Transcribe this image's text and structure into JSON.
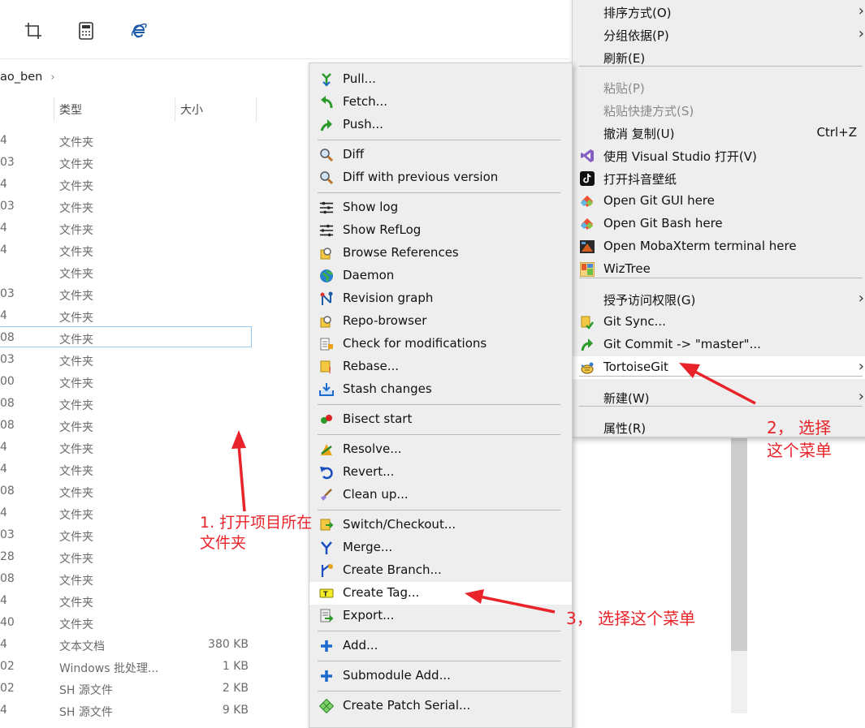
{
  "breadcrumb": {
    "current": "ao_ben",
    "sep": "›"
  },
  "columns": {
    "type": "类型",
    "size": "大小"
  },
  "files": [
    {
      "date": "4",
      "type": "文件夹",
      "size": ""
    },
    {
      "date": "03",
      "type": "文件夹",
      "size": ""
    },
    {
      "date": "4",
      "type": "文件夹",
      "size": ""
    },
    {
      "date": "03",
      "type": "文件夹",
      "size": ""
    },
    {
      "date": "4",
      "type": "文件夹",
      "size": ""
    },
    {
      "date": "4",
      "type": "文件夹",
      "size": ""
    },
    {
      "date": "",
      "type": "文件夹",
      "size": ""
    },
    {
      "date": "03",
      "type": "文件夹",
      "size": ""
    },
    {
      "date": "4",
      "type": "文件夹",
      "size": ""
    },
    {
      "date": "08",
      "type": "文件夹",
      "size": ""
    },
    {
      "date": "03",
      "type": "文件夹",
      "size": ""
    },
    {
      "date": "00",
      "type": "文件夹",
      "size": ""
    },
    {
      "date": "08",
      "type": "文件夹",
      "size": ""
    },
    {
      "date": "08",
      "type": "文件夹",
      "size": ""
    },
    {
      "date": "4",
      "type": "文件夹",
      "size": ""
    },
    {
      "date": "4",
      "type": "文件夹",
      "size": ""
    },
    {
      "date": "08",
      "type": "文件夹",
      "size": ""
    },
    {
      "date": "4",
      "type": "文件夹",
      "size": ""
    },
    {
      "date": "03",
      "type": "文件夹",
      "size": ""
    },
    {
      "date": "28",
      "type": "文件夹",
      "size": ""
    },
    {
      "date": "08",
      "type": "文件夹",
      "size": ""
    },
    {
      "date": "4",
      "type": "文件夹",
      "size": ""
    },
    {
      "date": "40",
      "type": "文件夹",
      "size": ""
    },
    {
      "date": "4",
      "type": "文本文档",
      "size": "380 KB"
    },
    {
      "date": "02",
      "type": "Windows 批处理...",
      "size": "1 KB"
    },
    {
      "date": "02",
      "type": "SH 源文件",
      "size": "2 KB"
    },
    {
      "date": "4",
      "type": "SH 源文件",
      "size": "9 KB"
    }
  ],
  "context_menu": {
    "items": [
      {
        "label": "排序方式(O)",
        "shortcut": "",
        "submenu": true,
        "disabled": false
      },
      {
        "label": "分组依据(P)",
        "shortcut": "",
        "submenu": true,
        "disabled": false
      },
      {
        "label": "刷新(E)",
        "shortcut": "",
        "submenu": false,
        "disabled": false
      },
      {
        "label": "粘贴(P)",
        "shortcut": "",
        "submenu": false,
        "disabled": true
      },
      {
        "label": "粘贴快捷方式(S)",
        "shortcut": "",
        "submenu": false,
        "disabled": true
      },
      {
        "label": "撤消 复制(U)",
        "shortcut": "Ctrl+Z",
        "submenu": false,
        "disabled": false
      },
      {
        "label": "使用 Visual Studio 打开(V)",
        "shortcut": "",
        "submenu": false,
        "disabled": false
      },
      {
        "label": "打开抖音壁纸",
        "shortcut": "",
        "submenu": false,
        "disabled": false
      },
      {
        "label": "Open Git GUI here",
        "shortcut": "",
        "submenu": false,
        "disabled": false
      },
      {
        "label": "Open Git Bash here",
        "shortcut": "",
        "submenu": false,
        "disabled": false
      },
      {
        "label": "Open MobaXterm terminal here",
        "shortcut": "",
        "submenu": false,
        "disabled": false
      },
      {
        "label": "WizTree",
        "shortcut": "",
        "submenu": false,
        "disabled": false
      },
      {
        "label": "授予访问权限(G)",
        "shortcut": "",
        "submenu": true,
        "disabled": false
      },
      {
        "label": "Git Sync...",
        "shortcut": "",
        "submenu": false,
        "disabled": false
      },
      {
        "label": "Git Commit -> \"master\"...",
        "shortcut": "",
        "submenu": false,
        "disabled": false
      },
      {
        "label": "TortoiseGit",
        "shortcut": "",
        "submenu": true,
        "disabled": false
      },
      {
        "label": "新建(W)",
        "shortcut": "",
        "submenu": true,
        "disabled": false
      },
      {
        "label": "属性(R)",
        "shortcut": "",
        "submenu": false,
        "disabled": false
      }
    ]
  },
  "tortoise_menu": {
    "items": [
      {
        "label": "Pull..."
      },
      {
        "label": "Fetch..."
      },
      {
        "label": "Push..."
      },
      {
        "label": "Diff"
      },
      {
        "label": "Diff with previous version"
      },
      {
        "label": "Show log"
      },
      {
        "label": "Show RefLog"
      },
      {
        "label": "Browse References"
      },
      {
        "label": "Daemon"
      },
      {
        "label": "Revision graph"
      },
      {
        "label": "Repo-browser"
      },
      {
        "label": "Check for modifications"
      },
      {
        "label": "Rebase..."
      },
      {
        "label": "Stash changes"
      },
      {
        "label": "Bisect start"
      },
      {
        "label": "Resolve..."
      },
      {
        "label": "Revert..."
      },
      {
        "label": "Clean up..."
      },
      {
        "label": "Switch/Checkout..."
      },
      {
        "label": "Merge..."
      },
      {
        "label": "Create Branch..."
      },
      {
        "label": "Create Tag..."
      },
      {
        "label": "Export..."
      },
      {
        "label": "Add..."
      },
      {
        "label": "Submodule Add..."
      },
      {
        "label": "Create Patch Serial..."
      }
    ]
  },
  "annotations": {
    "step1": [
      "1. 打开项目所在",
      "文件夹"
    ],
    "step2": [
      "2， 选择",
      "这个菜单"
    ],
    "step3": "3， 选择这个菜单",
    "color": "#e8242a"
  }
}
